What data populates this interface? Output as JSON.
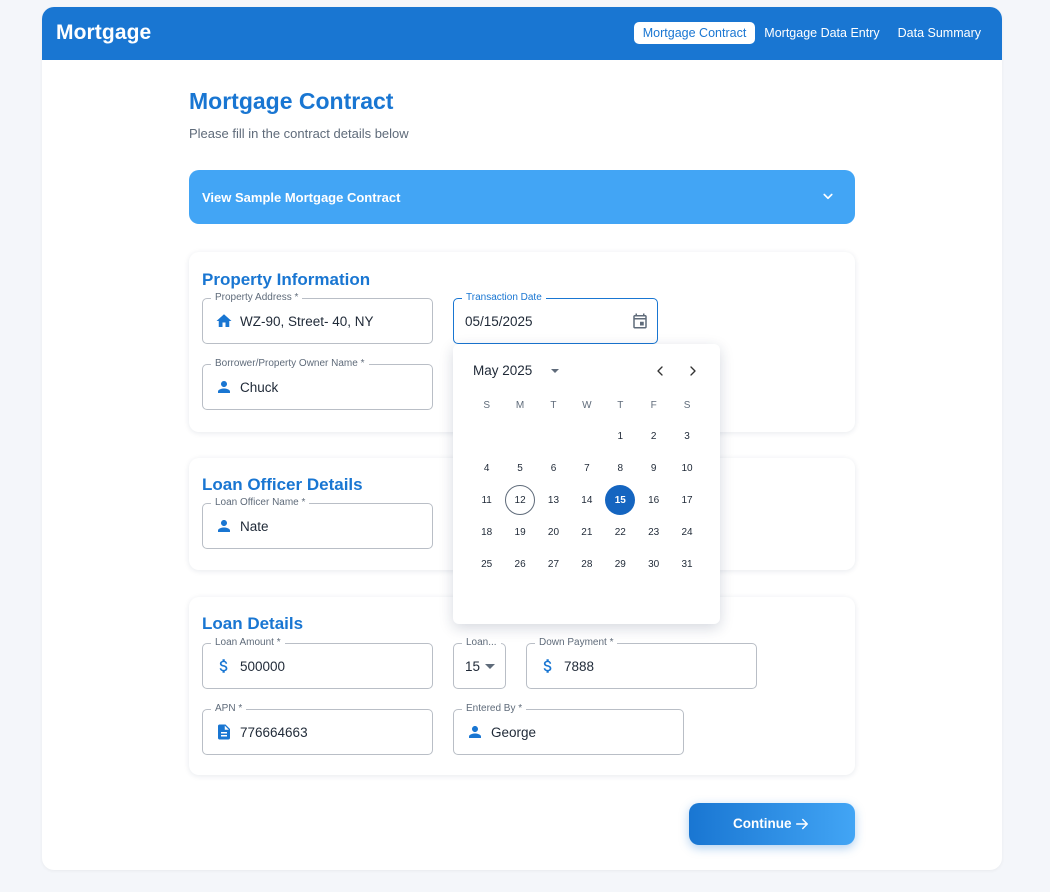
{
  "app": {
    "brand": "Mortgage",
    "nav": [
      {
        "label": "Mortgage Contract",
        "active": true
      },
      {
        "label": "Mortgage Data Entry",
        "active": false
      },
      {
        "label": "Data Summary",
        "active": false
      }
    ]
  },
  "page": {
    "title": "Mortgage Contract",
    "subtitle": "Please fill in the contract details below"
  },
  "sample": {
    "label": "View Sample Mortgage Contract"
  },
  "property": {
    "title": "Property Information",
    "address": {
      "label": "Property Address *",
      "value": "WZ-90, Street- 40, NY"
    },
    "transaction_date": {
      "label": "Transaction Date",
      "value": "05/15/2025"
    },
    "owner": {
      "label": "Borrower/Property Owner Name *",
      "value": "Chuck"
    }
  },
  "officer": {
    "title": "Loan Officer Details",
    "name": {
      "label": "Loan Officer Name *",
      "value": "Nate"
    }
  },
  "loan": {
    "title": "Loan Details",
    "amount": {
      "label": "Loan Amount *",
      "value": "500000"
    },
    "term": {
      "label": "Loan...",
      "value": "15"
    },
    "down_payment": {
      "label": "Down Payment *",
      "value": "7888"
    },
    "apn": {
      "label": "APN *",
      "value": "776664663"
    },
    "entered_by": {
      "label": "Entered By *",
      "value": "George"
    }
  },
  "calendar": {
    "month_label": "May 2025",
    "weekdays": [
      "S",
      "M",
      "T",
      "W",
      "T",
      "F",
      "S"
    ],
    "weeks": [
      [
        "",
        "",
        "",
        "",
        "1",
        "2",
        "3"
      ],
      [
        "4",
        "5",
        "6",
        "7",
        "8",
        "9",
        "10"
      ],
      [
        "11",
        "12",
        "13",
        "14",
        "15",
        "16",
        "17"
      ],
      [
        "18",
        "19",
        "20",
        "21",
        "22",
        "23",
        "24"
      ],
      [
        "25",
        "26",
        "27",
        "28",
        "29",
        "30",
        "31"
      ]
    ],
    "today": "12",
    "selected": "15"
  },
  "actions": {
    "continue_label": "Continue"
  },
  "colors": {
    "primary": "#1976d2",
    "accent": "#42a5f5",
    "selected_day": "#1565c0"
  }
}
